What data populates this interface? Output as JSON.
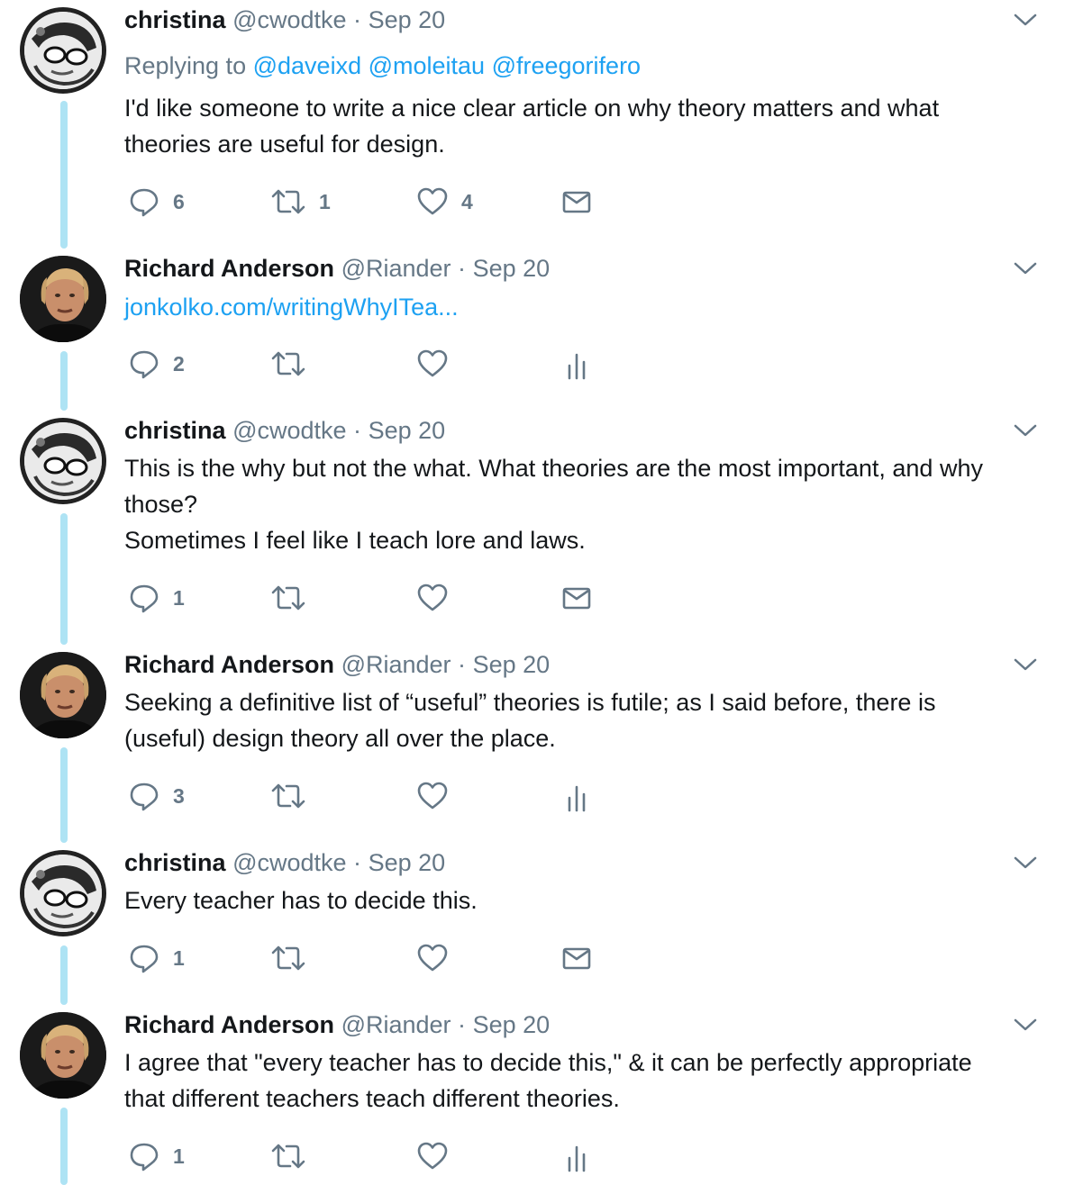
{
  "tweets": [
    {
      "name": "christina",
      "handle": "@cwodtke",
      "separator": "·",
      "date": "Sep 20",
      "replying_prefix": "Replying to",
      "replying_to": [
        "@daveixd",
        "@moleitau",
        "@freegorifero"
      ],
      "text_lines": [
        "I'd like someone to write a nice clear article on why theory matters and what",
        "theories are useful for design."
      ],
      "replies": "6",
      "retweets": "1",
      "likes": "4",
      "last_action": "dm-envelope-icon"
    },
    {
      "name": "Richard Anderson",
      "handle": "@Riander",
      "separator": "·",
      "date": "Sep 20",
      "link": "jonkolko.com/writingWhyITea...",
      "replies": "2",
      "retweets": "",
      "likes": "",
      "last_action": "analytics-icon"
    },
    {
      "name": "christina",
      "handle": "@cwodtke",
      "separator": "·",
      "date": "Sep 20",
      "text_lines": [
        "This is the why but not the what. What theories are the most important, and why",
        "those?",
        "Sometimes I feel like I teach lore and laws."
      ],
      "replies": "1",
      "retweets": "",
      "likes": "",
      "last_action": "dm-envelope-icon"
    },
    {
      "name": "Richard Anderson",
      "handle": "@Riander",
      "separator": "·",
      "date": "Sep 20",
      "text_lines": [
        "Seeking a definitive list of “useful” theories is futile; as I said before, there is",
        "(useful) design theory all over the place."
      ],
      "replies": "3",
      "retweets": "",
      "likes": "",
      "last_action": "analytics-icon"
    },
    {
      "name": "christina",
      "handle": "@cwodtke",
      "separator": "·",
      "date": "Sep 20",
      "text_lines": [
        "Every teacher has to decide this."
      ],
      "replies": "1",
      "retweets": "",
      "likes": "",
      "last_action": "dm-envelope-icon"
    },
    {
      "name": "Richard Anderson",
      "handle": "@Riander",
      "separator": "·",
      "date": "Sep 20",
      "text_lines": [
        "I agree that \"every teacher has to decide this,\" & it can be perfectly appropriate",
        "that different teachers teach different theories."
      ],
      "replies": "1",
      "retweets": "",
      "likes": "",
      "last_action": "analytics-icon"
    }
  ],
  "colors": {
    "thread_line": "#aee3f4",
    "link": "#1da1f2",
    "muted": "#657786",
    "text": "#14171a"
  }
}
